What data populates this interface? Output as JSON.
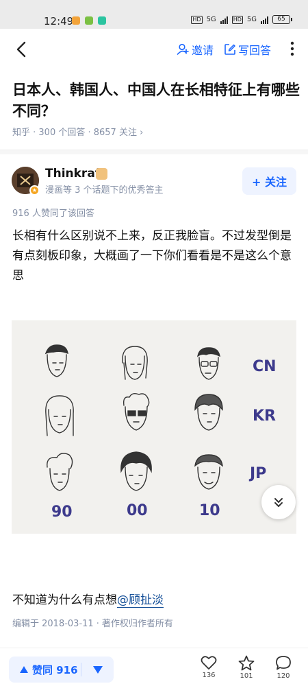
{
  "status_bar": {
    "time": "12:49",
    "network_1": "5G",
    "network_2": "5G",
    "battery": "65"
  },
  "nav": {
    "invite_label": "邀请",
    "write_answer_label": "写回答"
  },
  "question": {
    "title": "日本人、韩国人、中国人在长相特征上有哪些不同？",
    "meta": "知乎 · 300 个回答 · 8657 关注 ›"
  },
  "author": {
    "name": "Thinkraft",
    "description": "漫画等 3 个话题下的优秀答主",
    "follow_label": "+ 关注"
  },
  "answer": {
    "likes_line": "916 人赞同了该回答",
    "text": "长相有什么区别说不上来，反正我脸盲。不过发型倒是有点刻板印象，大概画了一下你们看看是不是这么个意思",
    "figure": {
      "row_labels": [
        "CN",
        "KR",
        "JP"
      ],
      "column_labels": [
        "90",
        "00",
        "10"
      ]
    },
    "after_text": "不知道为什么有点想",
    "mention": "@顾扯淡",
    "edited": "编辑于 2018-03-11",
    "copyright": "著作权归作者所有"
  },
  "bottom_bar": {
    "upvote_label": "赞同 916",
    "like_count": "136",
    "favorite_count": "101",
    "comment_count": "120"
  },
  "colors": {
    "accent": "#1a66ff",
    "accent_bg": "#eef3ff",
    "muted": "#8590a6",
    "figure_ink": "#3d3a8c"
  },
  "icons": [
    "back-arrow-icon",
    "add-user-icon",
    "edit-icon",
    "more-vertical-icon",
    "plus-icon",
    "expand-double-chevron-icon",
    "triangle-up-icon",
    "triangle-down-icon",
    "heart-icon",
    "star-icon",
    "comment-icon"
  ]
}
